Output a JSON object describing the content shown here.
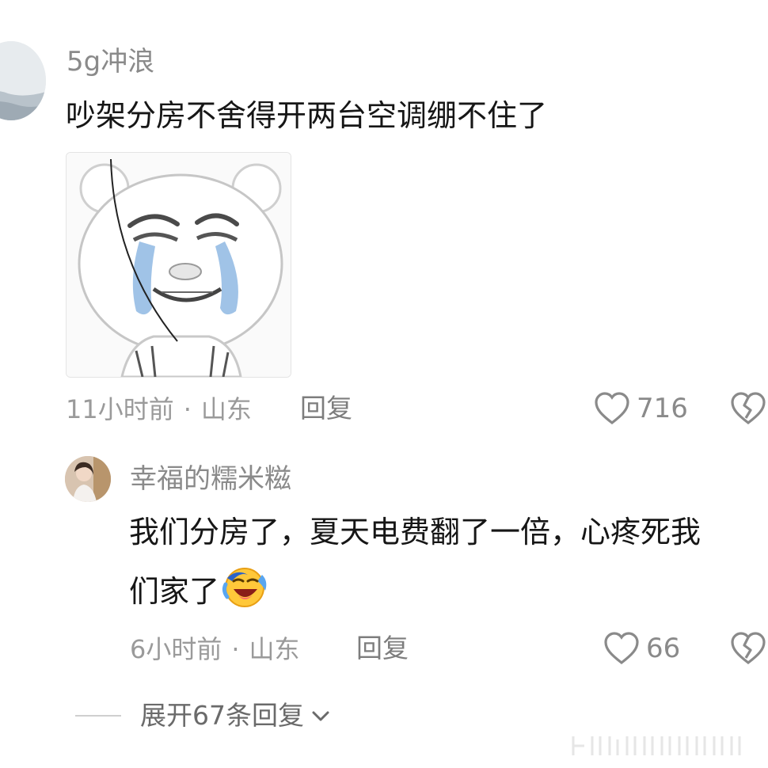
{
  "comment1": {
    "username": "5g冲浪",
    "text": "吵架分房不舍得开两台空调绷不住了",
    "time": "11小时前",
    "location": "山东",
    "reply_label": "回复",
    "likes": "716"
  },
  "comment2": {
    "username": "幸福的糯米糍",
    "text_line1": "我们分房了，夏天电费翻了一倍，心疼死我",
    "text_line2": "们家了",
    "time": "6小时前",
    "location": "山东",
    "reply_label": "回复",
    "likes": "66"
  },
  "expand_replies_label": "展开67条回复",
  "separator": "·"
}
